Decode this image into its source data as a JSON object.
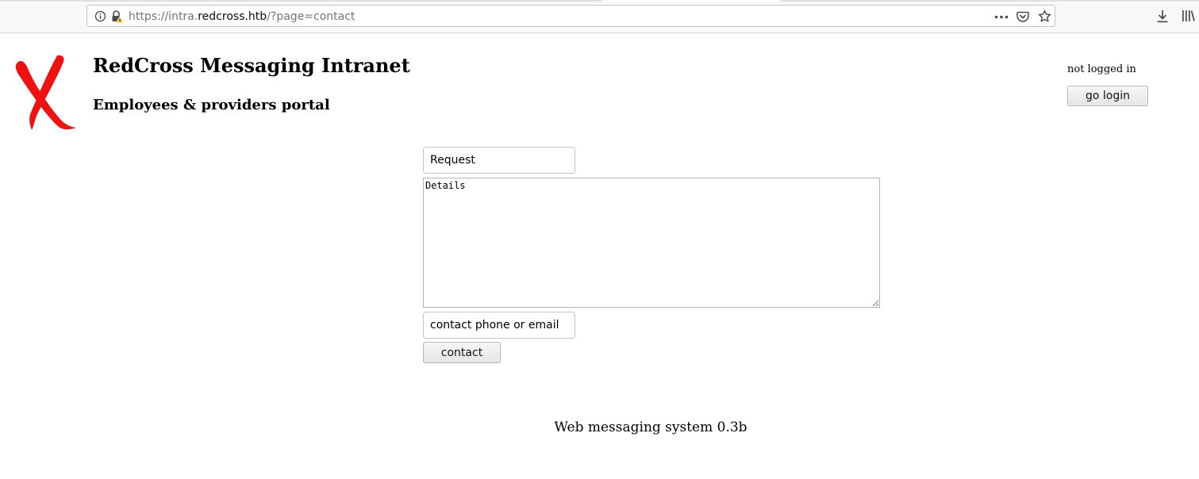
{
  "browser": {
    "url_prefix": "https://intra.",
    "url_host": "redcross.htb",
    "url_suffix": "/?page=contact",
    "icons": [
      "info-icon",
      "insecure-lock-icon",
      "more-actions-icon",
      "pocket-icon",
      "bookmark-star-icon",
      "download-icon",
      "library-icon"
    ]
  },
  "header": {
    "title": "RedCross Messaging Intranet",
    "subtitle": "Employees & providers portal",
    "logo_icon": "red-cross-x-logo",
    "logo_color": "#ee1111"
  },
  "auth": {
    "status": "not logged in",
    "login_label": "go login"
  },
  "contact_form": {
    "request_placeholder": "Request",
    "details_placeholder": "Details",
    "contact_placeholder": "contact phone or email",
    "submit_label": "contact"
  },
  "footer": {
    "version_text": "Web messaging system 0.3b"
  }
}
